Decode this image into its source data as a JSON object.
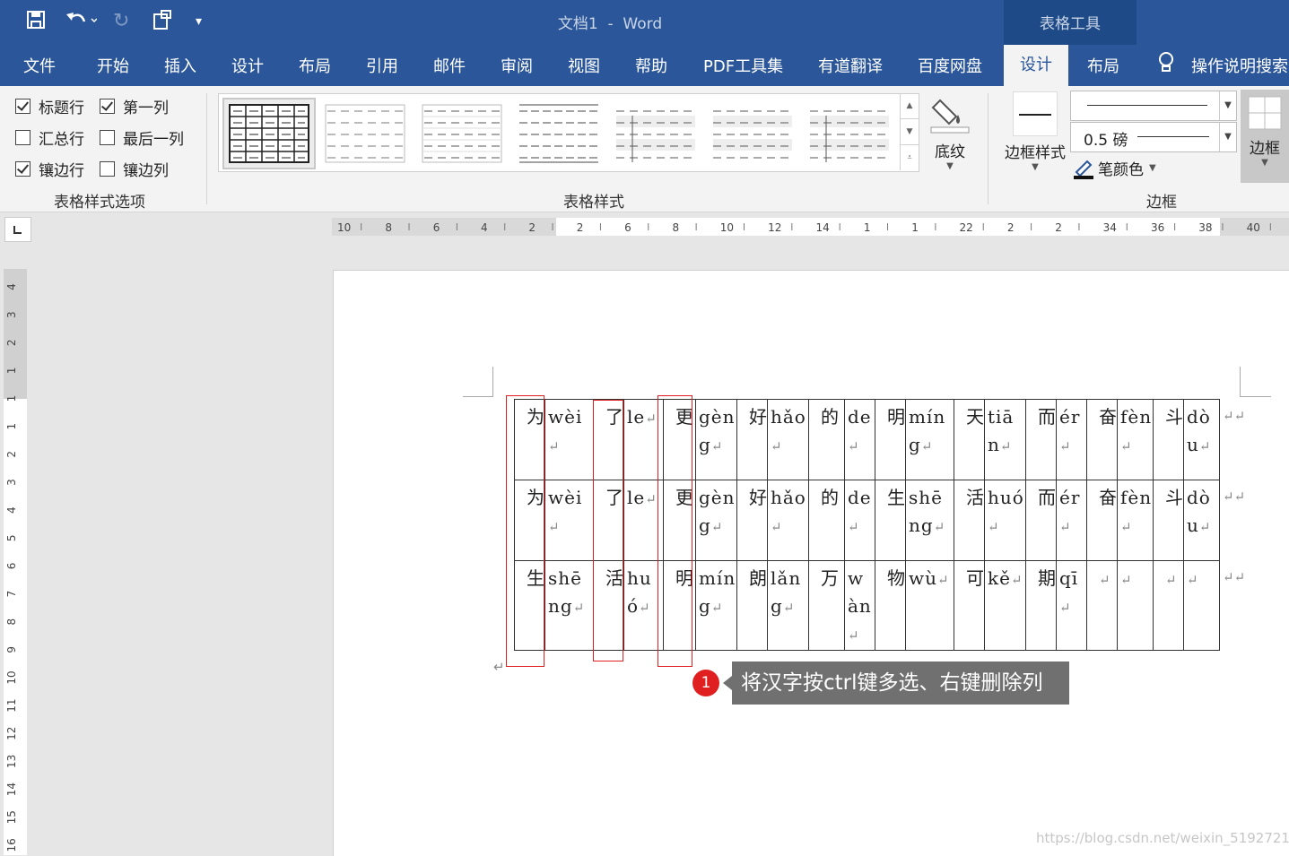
{
  "titlebar": {
    "title": "文档1  -  Word",
    "context_tool": "表格工具"
  },
  "tabs": [
    {
      "label": "文件"
    },
    {
      "label": "开始"
    },
    {
      "label": "插入"
    },
    {
      "label": "设计"
    },
    {
      "label": "布局"
    },
    {
      "label": "引用"
    },
    {
      "label": "邮件"
    },
    {
      "label": "审阅"
    },
    {
      "label": "视图"
    },
    {
      "label": "帮助"
    },
    {
      "label": "PDF工具集"
    },
    {
      "label": "有道翻译"
    },
    {
      "label": "百度网盘"
    },
    {
      "label": "设计"
    },
    {
      "label": "布局"
    },
    {
      "label": "操作说明搜索"
    }
  ],
  "ribbon": {
    "style_options": {
      "header_row": "标题行",
      "first_column": "第一列",
      "total_row": "汇总行",
      "last_column": "最后一列",
      "banded_rows": "镶边行",
      "banded_columns": "镶边列",
      "group_label": "表格样式选项",
      "checked": {
        "header_row": true,
        "first_column": true,
        "total_row": false,
        "last_column": false,
        "banded_rows": true,
        "banded_columns": false
      }
    },
    "table_styles": {
      "group_label": "表格样式",
      "shading": "底纹"
    },
    "borders": {
      "border_styles": "边框样式",
      "weight": "0.5 磅",
      "pen_color": "笔颜色",
      "borders_btn": "边框",
      "group_label": "边框"
    }
  },
  "ruler": {
    "h_labels": [
      "10",
      "8",
      "6",
      "4",
      "2",
      "2",
      "6",
      "8",
      "10",
      "12",
      "14",
      "1",
      "1",
      "22",
      "2",
      "2",
      "34",
      "36",
      "38",
      "40"
    ],
    "v_labels": [
      "4",
      "3",
      "2",
      "1",
      "1",
      "1",
      "2",
      "3",
      "4",
      "5",
      "6",
      "7",
      "8",
      "9",
      "10",
      "11",
      "12",
      "13",
      "14",
      "15",
      "16"
    ]
  },
  "table": {
    "rows": [
      [
        "为",
        "wèi",
        "了",
        "le",
        "更",
        "gèng",
        "好",
        "hǎo",
        "的",
        "de",
        "明",
        "míng",
        "天",
        "tiān",
        "而",
        "ér",
        "奋",
        "fèn",
        "斗",
        "dòu"
      ],
      [
        "为",
        "wèi",
        "了",
        "le",
        "更",
        "gèng",
        "好",
        "hǎo",
        "的",
        "de",
        "生",
        "shēng",
        "活",
        "huó",
        "而",
        "ér",
        "奋",
        "fèn",
        "斗",
        "dòu"
      ],
      [
        "生",
        "shēng",
        "活",
        "huó",
        "明",
        "míng",
        "朗",
        "lǎng",
        "万",
        "wàn",
        "物",
        "wù",
        "可",
        "kě",
        "期",
        "qī",
        "",
        "",
        "",
        ""
      ]
    ],
    "return_mark": "↵"
  },
  "callout": {
    "badge": "1",
    "text": "将汉字按ctrl键多选、右键删除列"
  },
  "watermark": "https://blog.csdn.net/weixin_51927215"
}
